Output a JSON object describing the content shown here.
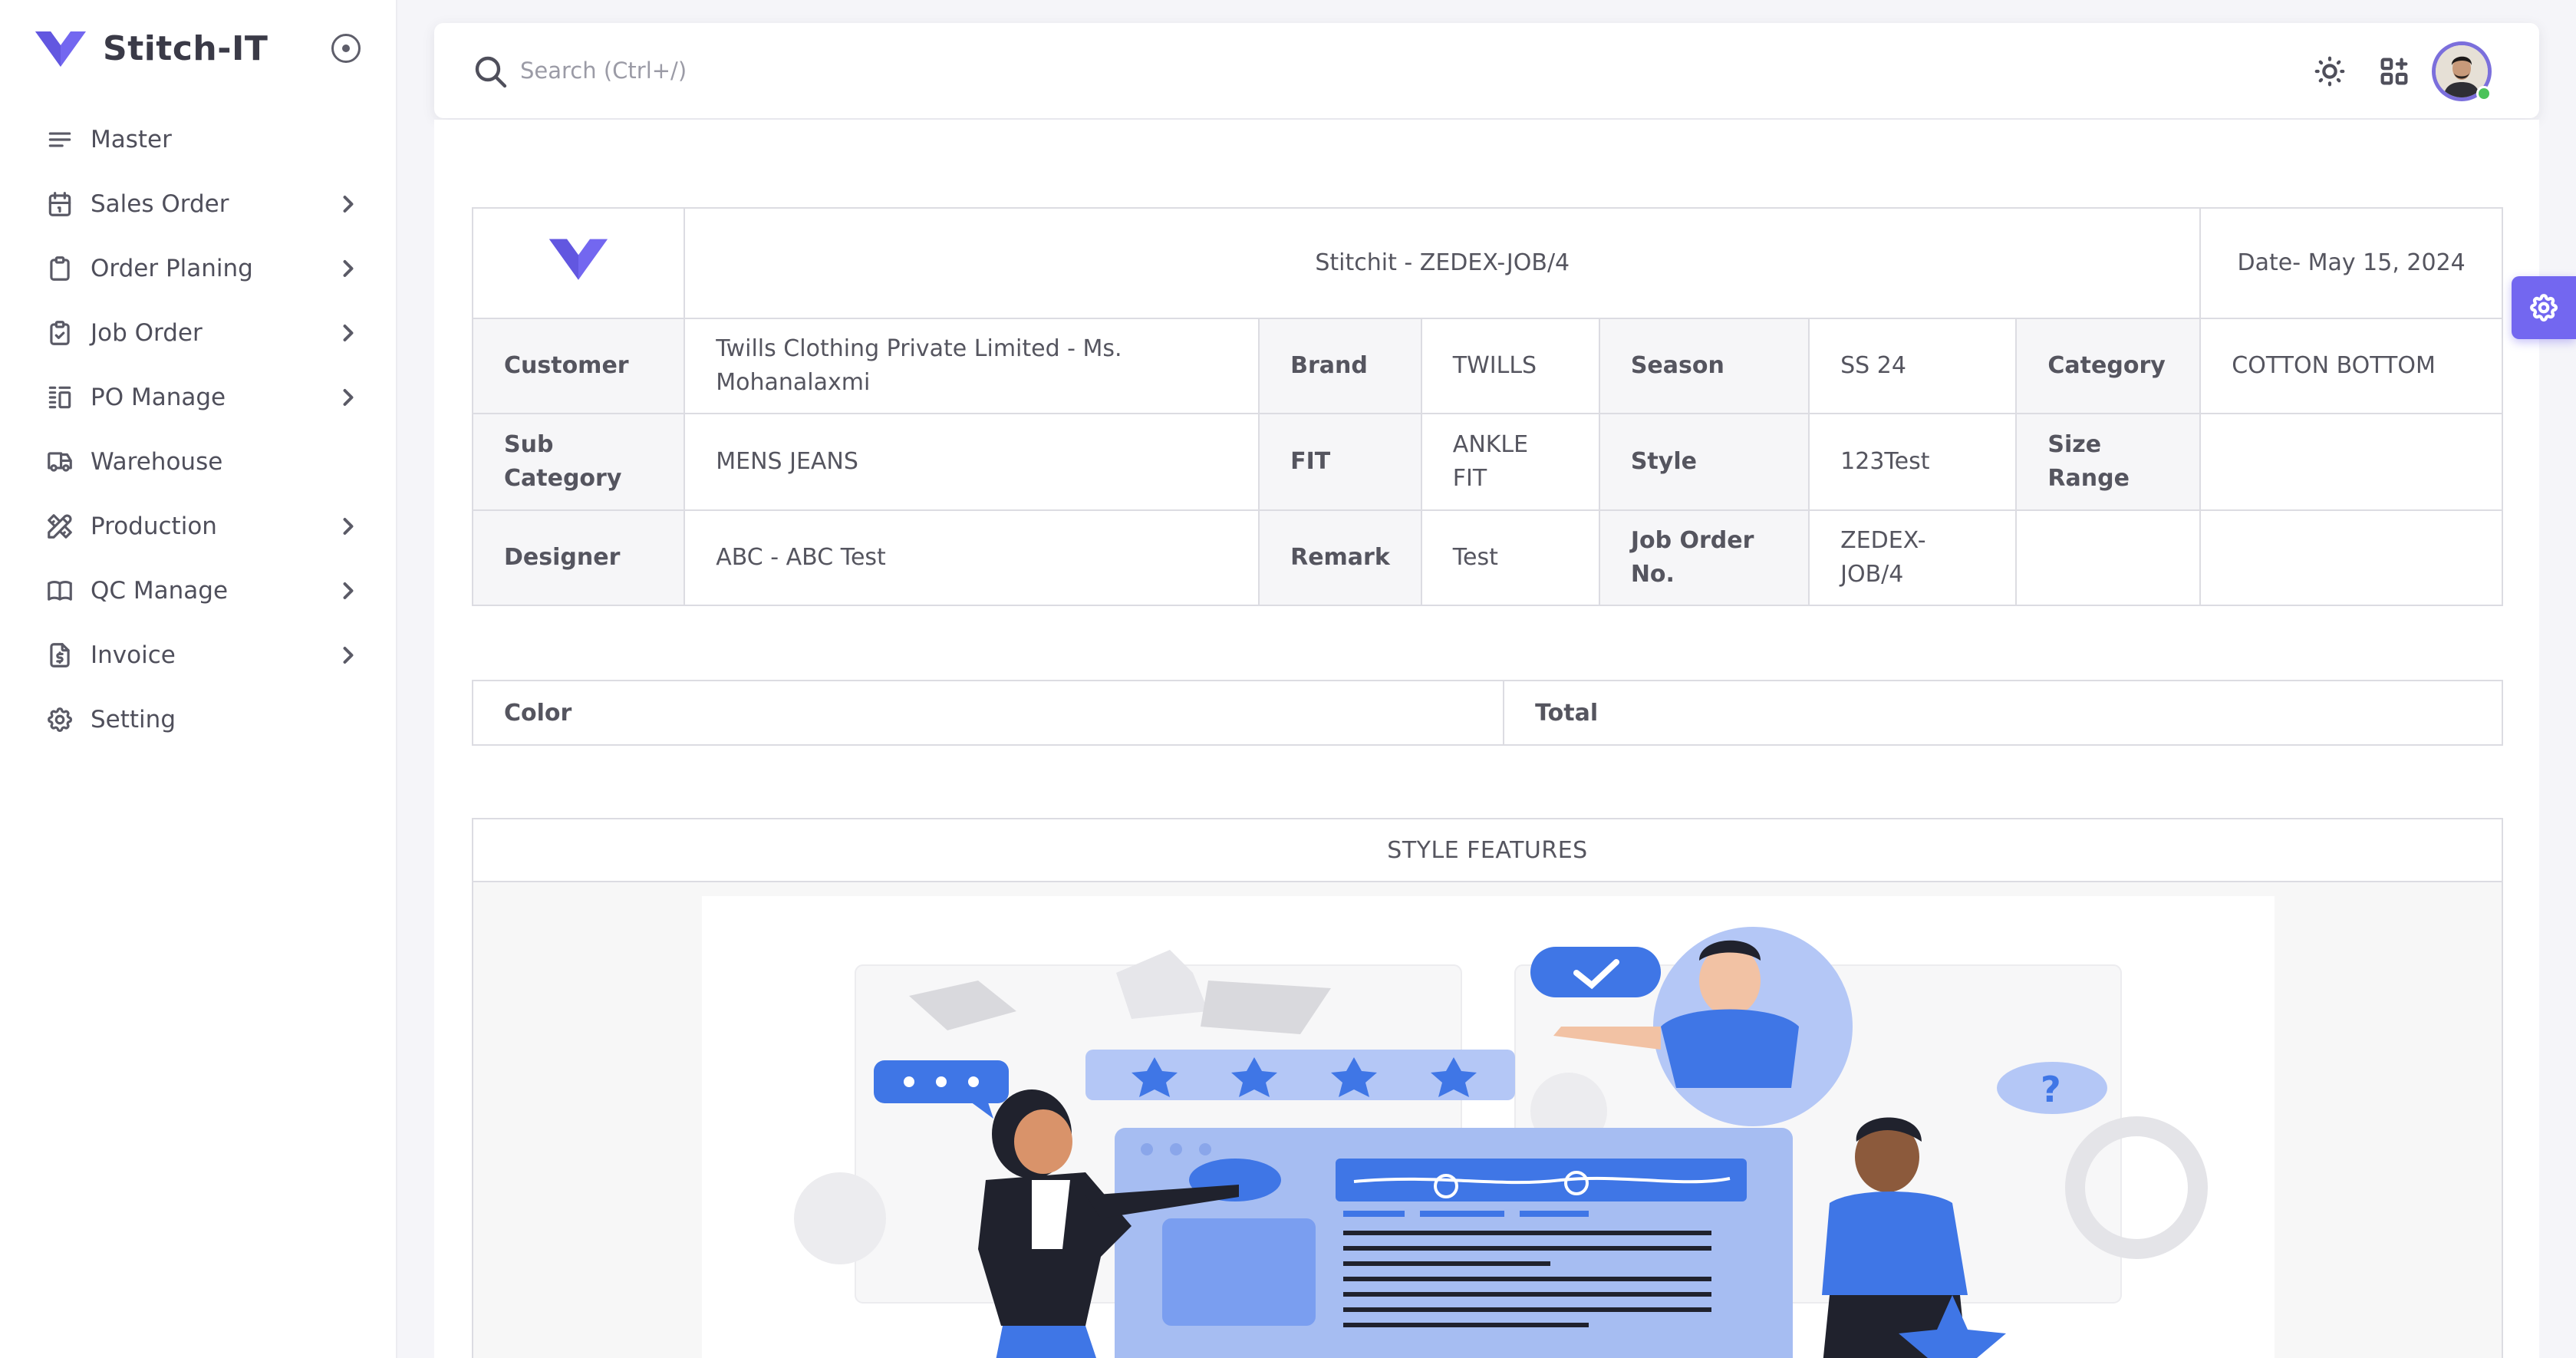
{
  "brand": {
    "name": "Stitch-IT",
    "color": "#7367f0"
  },
  "nav": {
    "items": [
      {
        "label": "Master",
        "icon": "menu-icon",
        "has_children": false
      },
      {
        "label": "Sales Order",
        "icon": "calendar-icon",
        "has_children": true
      },
      {
        "label": "Order Planing",
        "icon": "clipboard-icon",
        "has_children": true
      },
      {
        "label": "Job Order",
        "icon": "clipboard-check-icon",
        "has_children": true
      },
      {
        "label": "PO Manage",
        "icon": "columns-icon",
        "has_children": true
      },
      {
        "label": "Warehouse",
        "icon": "truck-icon",
        "has_children": false
      },
      {
        "label": "Production",
        "icon": "tools-icon",
        "has_children": true
      },
      {
        "label": "QC Manage",
        "icon": "book-icon",
        "has_children": true
      },
      {
        "label": "Invoice",
        "icon": "invoice-icon",
        "has_children": true
      },
      {
        "label": "Setting",
        "icon": "gear-icon",
        "has_children": false
      }
    ]
  },
  "search": {
    "placeholder": "Search (Ctrl+/)"
  },
  "topbar": {
    "icons": [
      "sun-icon",
      "add-app-icon",
      "avatar"
    ]
  },
  "job": {
    "title": "Stitchit - ZEDEX-JOB/4",
    "date": "Date- May 15, 2024",
    "rows": [
      [
        {
          "label": "Customer",
          "value": "Twills Clothing Private Limited - Ms. Mohanalaxmi"
        },
        {
          "label": "Brand",
          "value": "TWILLS"
        },
        {
          "label": "Season",
          "value": "SS 24"
        },
        {
          "label": "Category",
          "value": "COTTON BOTTOM"
        }
      ],
      [
        {
          "label": "Sub Category",
          "value": "MENS JEANS"
        },
        {
          "label": "FIT",
          "value": "ANKLE FIT"
        },
        {
          "label": "Style",
          "value": "123Test"
        },
        {
          "label": "Size Range",
          "value": ""
        }
      ],
      [
        {
          "label": "Designer",
          "value": "ABC - ABC Test"
        },
        {
          "label": "Remark",
          "value": "Test"
        },
        {
          "label": "Job Order No.",
          "value": "ZEDEX-JOB/4"
        },
        {
          "label": "",
          "value": ""
        }
      ]
    ]
  },
  "color_table": {
    "col1": "Color",
    "col2": "Total"
  },
  "style_features": {
    "heading": "STYLE FEATURES"
  }
}
